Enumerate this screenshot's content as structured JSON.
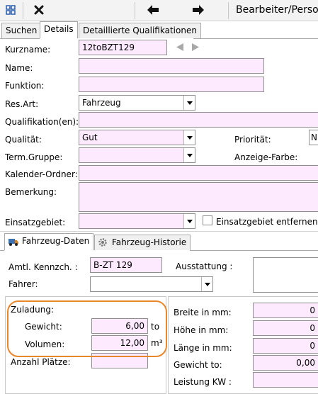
{
  "toolbar": {
    "grid_icon": "grid-icon",
    "close_icon": "close-icon",
    "back_icon": "arrow-left-icon",
    "forward_icon": "arrow-right-icon",
    "title": "Bearbeiter/Perso"
  },
  "tabs": [
    {
      "label": "Suchen"
    },
    {
      "label": "Details"
    },
    {
      "label": "Detaillierte Qualifikationen"
    }
  ],
  "form": {
    "kurzname": {
      "label": "Kurzname:",
      "value": "12toBZT129"
    },
    "name": {
      "label": "Name:",
      "value": ""
    },
    "funktion": {
      "label": "Funktion:",
      "value": ""
    },
    "resart": {
      "label": "Res.Art:",
      "value": "Fahrzeug"
    },
    "qualifikation": {
      "label": "Qualifikation(en):",
      "value": ""
    },
    "qualitaet": {
      "label": "Qualität:",
      "value": "Gut"
    },
    "prioritaet": {
      "label": "Priorität:",
      "value": "N"
    },
    "termgruppe": {
      "label": "Term.Gruppe:",
      "value": ""
    },
    "anzeigefarbe": {
      "label": "Anzeige-Farbe:"
    },
    "kalenderordner": {
      "label": "Kalender-Ordner:",
      "value": ""
    },
    "bemerkung": {
      "label": "Bemerkung:",
      "value": ""
    },
    "einsatzgebiet": {
      "label": "Einsatzgebiet:",
      "value": ""
    },
    "einsatzgebiet_entfernen": {
      "label": "Einsatzgebiet entfernen",
      "checked": false
    }
  },
  "subtabs": [
    {
      "label": "Fahrzeug-Daten",
      "icon": "vehicle-icon"
    },
    {
      "label": "Fahrzeug-Historie",
      "icon": "gear-icon"
    }
  ],
  "fahrzeug": {
    "kennzeichen": {
      "label": "Amtl. Kennzch. :",
      "value": "B-ZT 129"
    },
    "ausstattung": {
      "label": "Ausstattung :",
      "value": ""
    },
    "fahrer": {
      "label": "Fahrer:",
      "value": ""
    },
    "zuladung": {
      "label": "Zuladung:"
    },
    "gewicht": {
      "label": "Gewicht:",
      "value": "6,00",
      "unit": "to"
    },
    "volumen": {
      "label": "Volumen:",
      "value": "12,00",
      "unit": "m³"
    },
    "anzahl_plaetze": {
      "label": "Anzahl Plätze:",
      "value": ""
    },
    "breite": {
      "label": "Breite in mm:",
      "value": "0"
    },
    "hoehe": {
      "label": "Höhe in mm:",
      "value": "0"
    },
    "laenge": {
      "label": "Länge in mm:",
      "value": "0"
    },
    "gewicht_to": {
      "label": "Gewicht to:",
      "value": "0,00"
    },
    "leistung": {
      "label": "Leistung KW :",
      "value": ""
    }
  },
  "colors": {
    "field_bg": "#fdeaff",
    "highlight_outline": "#e8862a"
  }
}
